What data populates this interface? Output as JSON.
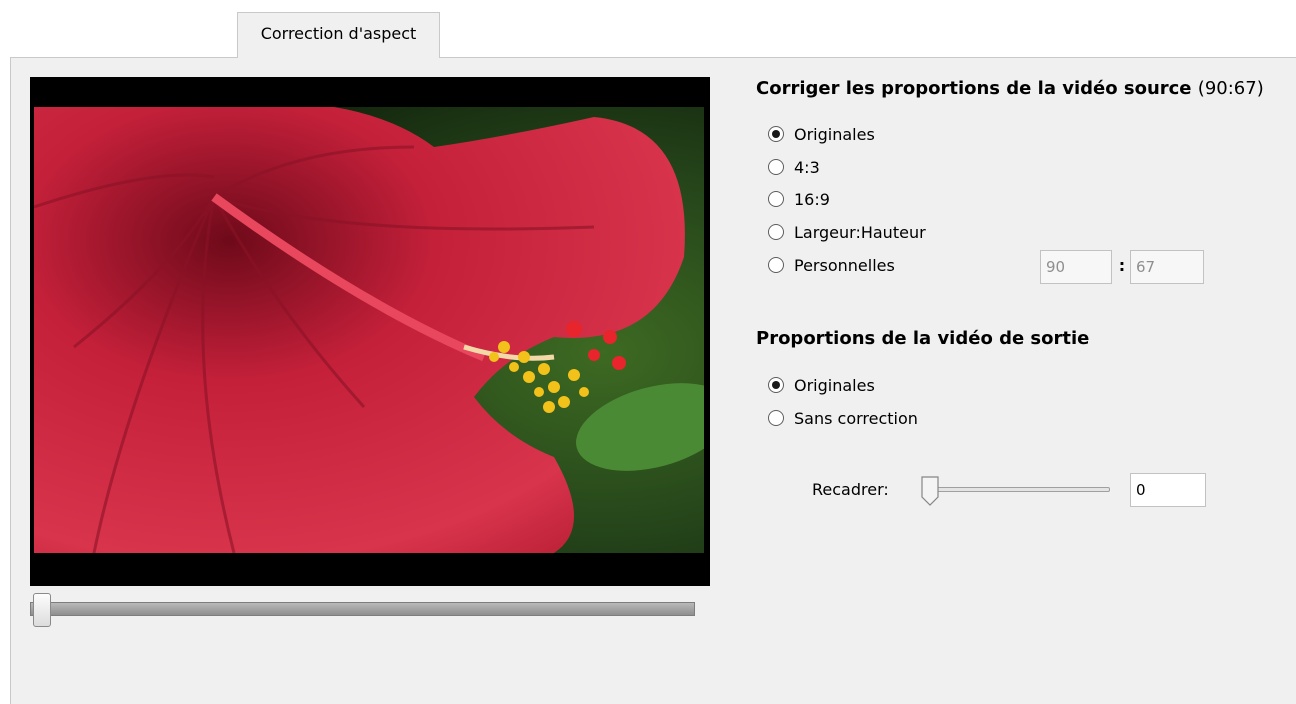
{
  "tab": {
    "label": "Correction d'aspect"
  },
  "source_section": {
    "heading": "Corriger les proportions de la vidéo source",
    "ratio": "(90:67)",
    "options": [
      {
        "label": "Originales",
        "selected": true
      },
      {
        "label": "4:3",
        "selected": false
      },
      {
        "label": "16:9",
        "selected": false
      },
      {
        "label": "Largeur:Hauteur",
        "selected": false
      },
      {
        "label": "Personnelles",
        "selected": false
      }
    ],
    "custom_width": "90",
    "custom_separator": ":",
    "custom_height": "67"
  },
  "output_section": {
    "heading": "Proportions de la vidéo de sortie",
    "options": [
      {
        "label": "Originales",
        "selected": true
      },
      {
        "label": "Sans correction",
        "selected": false
      }
    ],
    "crop_label": "Recadrer:",
    "crop_value": "0",
    "crop_slider_position": 0
  },
  "preview": {
    "seek_position": 0
  }
}
